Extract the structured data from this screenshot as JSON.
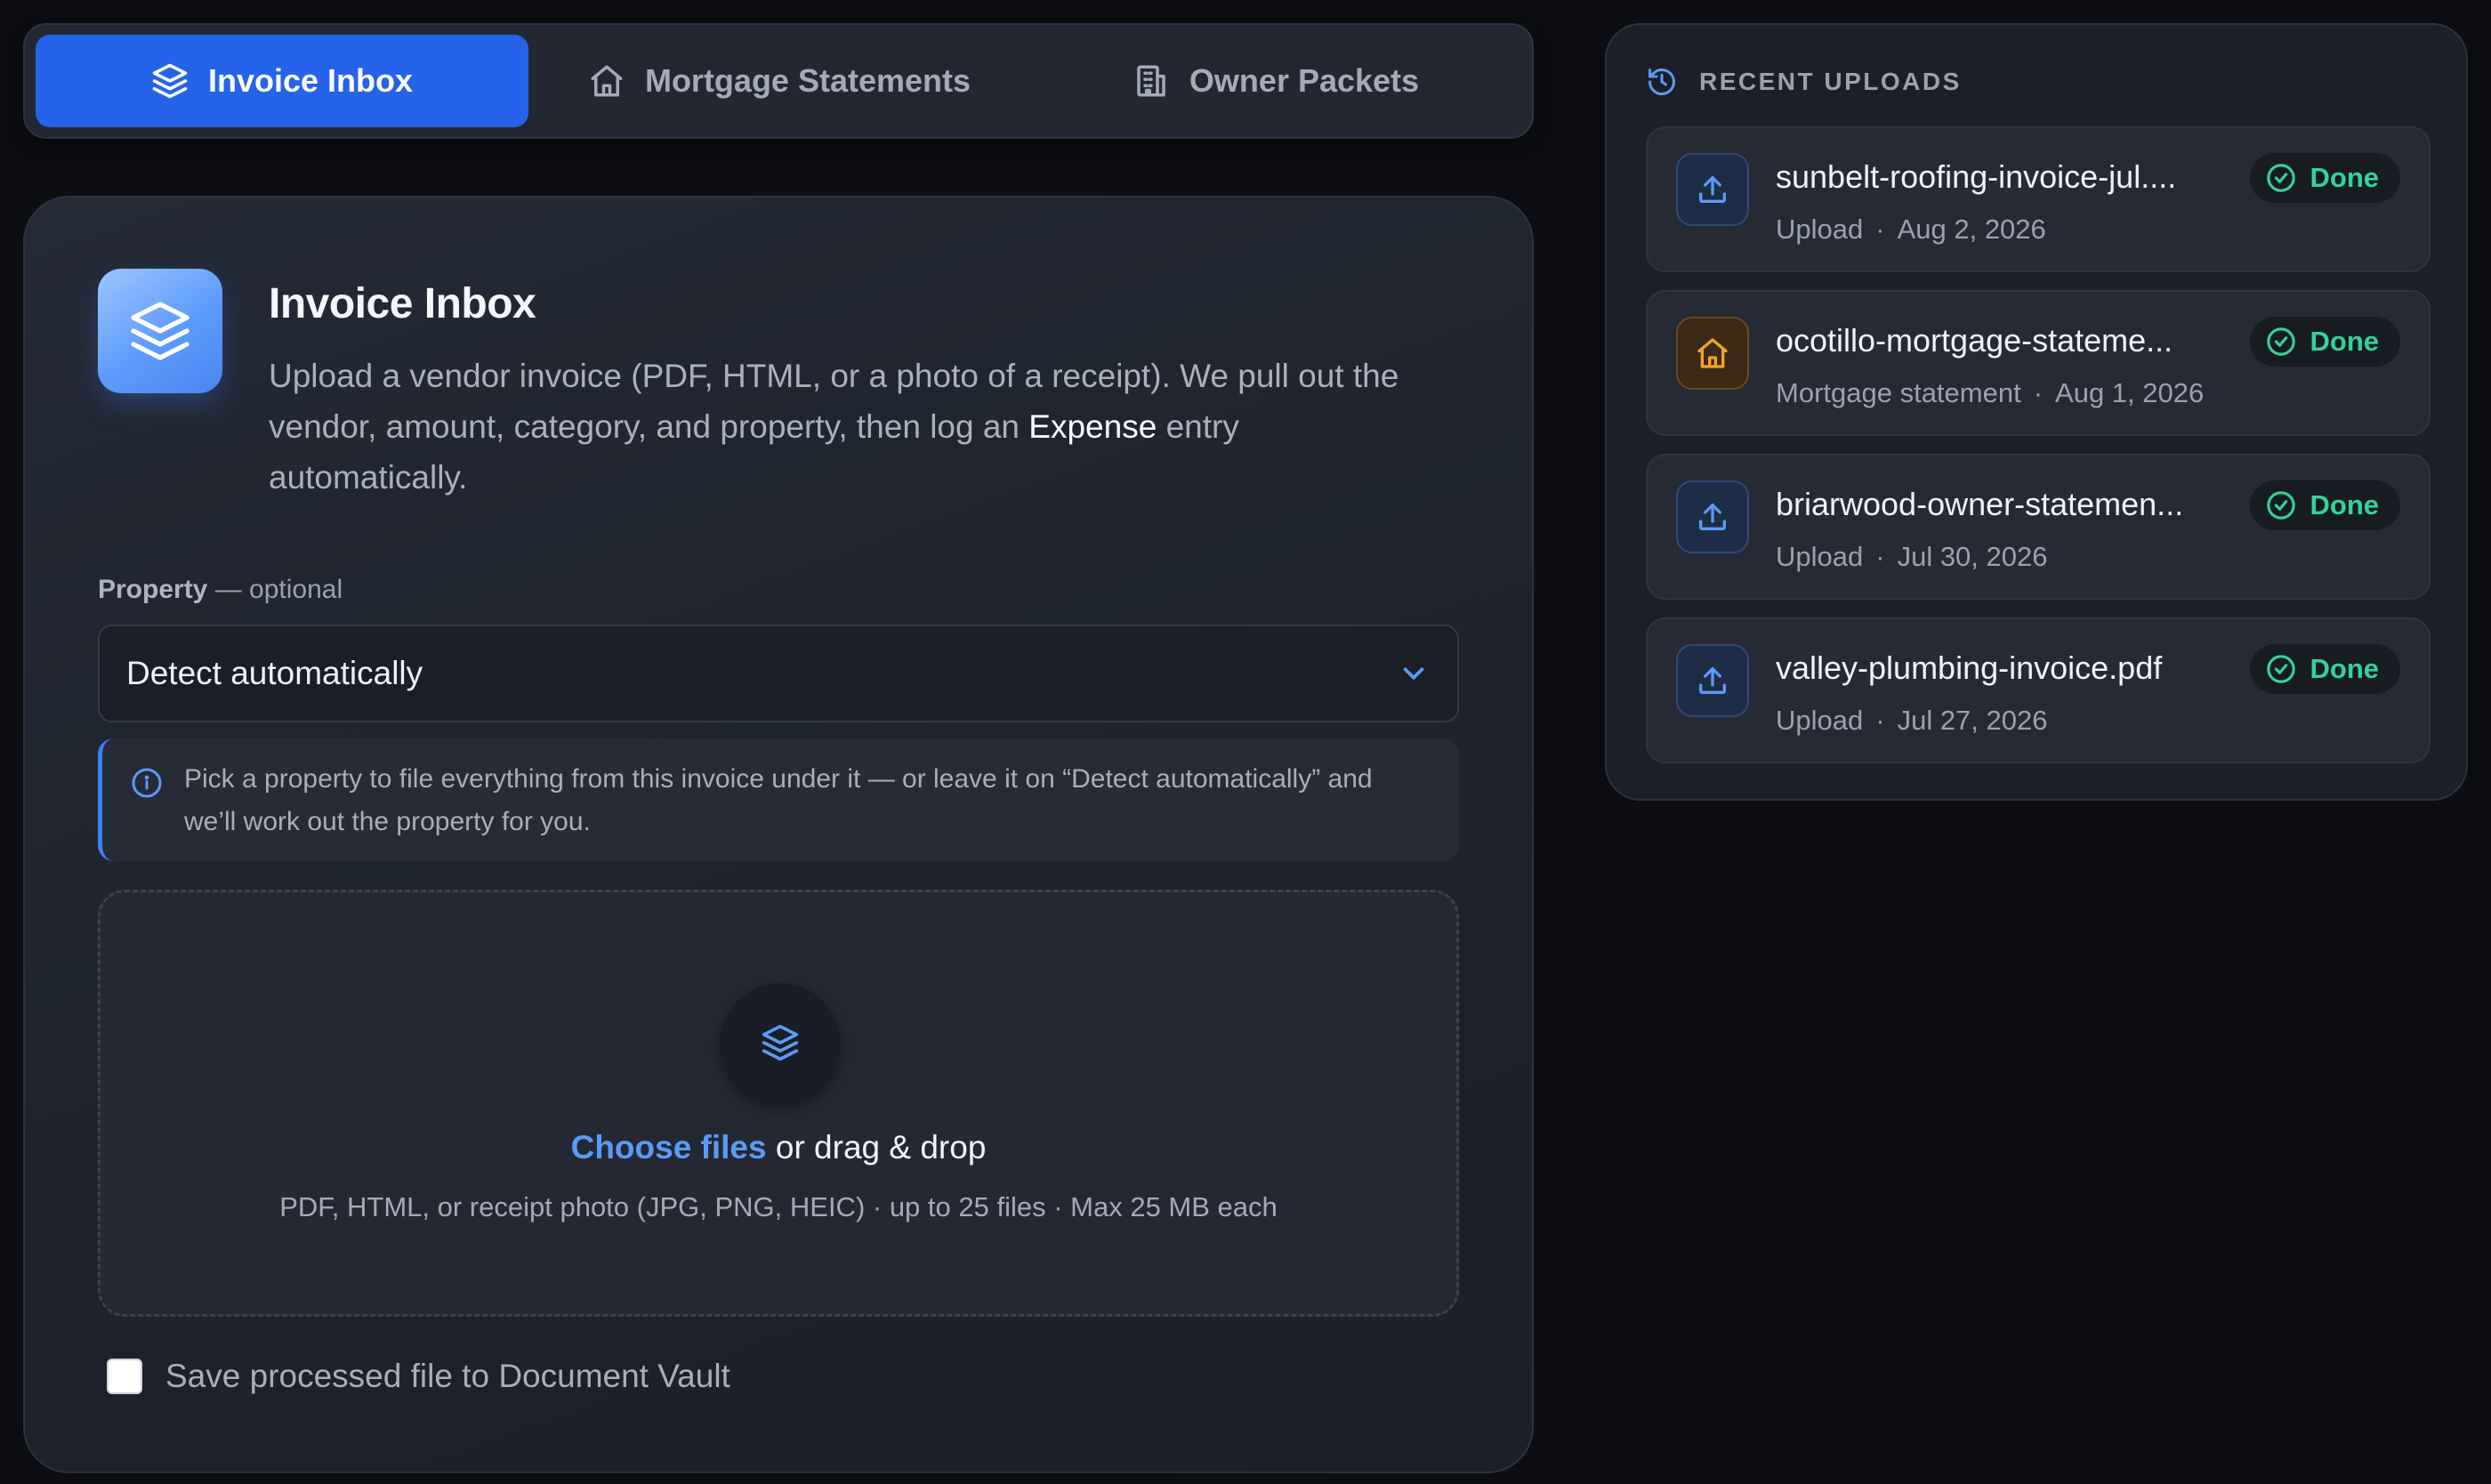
{
  "tabs": [
    {
      "label": "Invoice Inbox",
      "icon": "layers-icon",
      "active": true
    },
    {
      "label": "Mortgage Statements",
      "icon": "home-icon",
      "active": false
    },
    {
      "label": "Owner Packets",
      "icon": "building-icon",
      "active": false
    }
  ],
  "main": {
    "title": "Invoice Inbox",
    "description_before": "Upload a vendor invoice (PDF, HTML, or a photo of a receipt). We pull out the vendor, amount, category, and property, then log an ",
    "description_highlight": "Expense",
    "description_after": " entry automatically.",
    "property_label": "Property",
    "property_suffix": " — optional",
    "property_value": "Detect automatically",
    "info_text": "Pick a property to file everything from this invoice under it — or leave it on “Detect automatically” and we’ll work out the property for you.",
    "dropzone": {
      "link_label": "Choose files",
      "rest_label": " or drag & drop",
      "hint": "PDF, HTML, or receipt photo (JPG, PNG, HEIC) · up to 25 files · Max 25 MB each"
    },
    "save_checkbox_label": "Save processed file to Document Vault",
    "save_checked": false
  },
  "recent_uploads": {
    "title": "RECENT UPLOADS",
    "items": [
      {
        "name": "sunbelt-roofing-invoice-jul....",
        "type": "Upload",
        "date": "Aug 2, 2026",
        "status": "Done",
        "icon": "upload-icon"
      },
      {
        "name": "ocotillo-mortgage-stateme...",
        "type": "Mortgage statement",
        "date": "Aug 1, 2026",
        "status": "Done",
        "icon": "home-icon"
      },
      {
        "name": "briarwood-owner-statemen...",
        "type": "Upload",
        "date": "Jul 30, 2026",
        "status": "Done",
        "icon": "upload-icon"
      },
      {
        "name": "valley-plumbing-invoice.pdf",
        "type": "Upload",
        "date": "Jul 27, 2026",
        "status": "Done",
        "icon": "upload-icon"
      }
    ]
  },
  "colors": {
    "accent": "#2563eb",
    "link": "#5b9bf5",
    "success": "#34d399",
    "amber": "#f5a524",
    "background": "#0c0e13"
  }
}
